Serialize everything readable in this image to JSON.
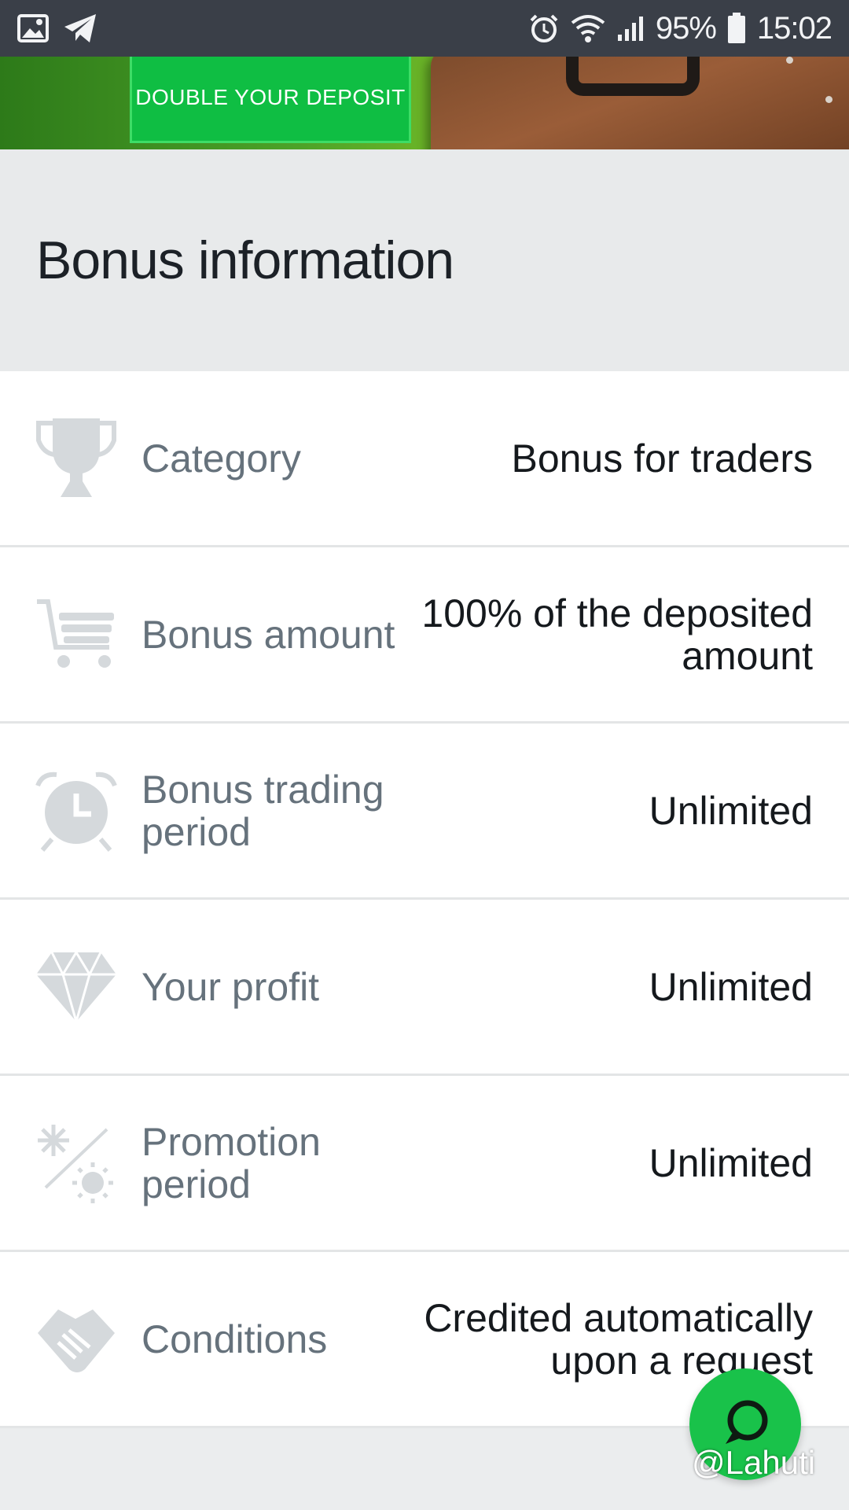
{
  "status_bar": {
    "battery": "95%",
    "time": "15:02",
    "icons": [
      "gallery-icon",
      "telegram-icon",
      "alarm-icon",
      "wifi-icon",
      "signal-icon",
      "battery-icon"
    ]
  },
  "banner": {
    "button_label": "DOUBLE YOUR DEPOSIT"
  },
  "header": {
    "title": "Bonus information"
  },
  "rows": [
    {
      "icon": "trophy-icon",
      "label": "Category",
      "value": "Bonus for traders"
    },
    {
      "icon": "cart-icon",
      "label": "Bonus amount",
      "value": "100% of the deposited amount"
    },
    {
      "icon": "alarm-clock-icon",
      "label": "Bonus trading period",
      "value": "Unlimited"
    },
    {
      "icon": "diamond-icon",
      "label": "Your profit",
      "value": "Unlimited"
    },
    {
      "icon": "season-icon",
      "label": "Promotion period",
      "value": "Unlimited"
    },
    {
      "icon": "handshake-icon",
      "label": "Conditions",
      "value": "Credited automatically upon a request"
    }
  ],
  "chat": {
    "icon": "chat-bubble-icon"
  },
  "watermark": "@Lahuti",
  "colors": {
    "status_bar_bg": "#3a3f48",
    "accent_green": "#19c24a",
    "header_bg": "#e8eaeb",
    "label_text": "#66727c",
    "value_text": "#15191d",
    "icon_gray": "#d5d9dc"
  }
}
